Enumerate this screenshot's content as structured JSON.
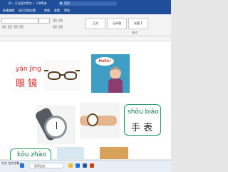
{
  "window": {
    "title": "四 • 正在容对等文 • 下穿等参",
    "search_placeholder": "搜索"
  },
  "ribbon": {
    "tabs": [
      "新基编辑",
      "连行添加位置",
      "审阅",
      "查看",
      "帮助"
    ],
    "styles": [
      "正文",
      "无间隔",
      "标题 1"
    ],
    "group_label": "样式"
  },
  "document": {
    "word1": {
      "pinyin": "yǎn jìng",
      "hanzi": "眼  镜"
    },
    "word2": {
      "pinyin": "shǒu biǎo",
      "hanzi": "手  表"
    },
    "word3": {
      "pinyin": "kǒu zhào"
    },
    "bubble_text": "Hello!"
  },
  "taskbar": {
    "status": "中文 合文字数 •",
    "search_placeholder": "搜索此处"
  },
  "colors": {
    "title_bar": "#1f4e9b",
    "pinyin_red": "#d7261e",
    "pinyin_green": "#0f7a4a",
    "card_border": "#1f9a5a"
  }
}
